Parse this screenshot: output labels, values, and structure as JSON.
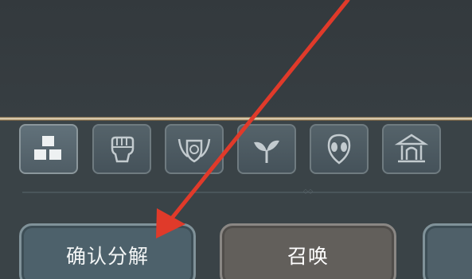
{
  "colors": {
    "accent_arrow": "#e03a2a",
    "gold_line": "#efe2c8",
    "panel_bg": "#3a4347",
    "tab_bg": "#4d5a61"
  },
  "tabs": [
    {
      "icon": "boxes-icon",
      "active": true
    },
    {
      "icon": "fist-icon",
      "active": false
    },
    {
      "icon": "winged-shield-icon",
      "active": false
    },
    {
      "icon": "sprout-icon",
      "active": false
    },
    {
      "icon": "alien-head-icon",
      "active": false
    },
    {
      "icon": "temple-icon",
      "active": false
    }
  ],
  "buttons": {
    "confirm_decompose": "确认分解",
    "summon": "召唤"
  },
  "annotation": {
    "type": "arrow",
    "points_to": "confirm-decompose-button"
  }
}
